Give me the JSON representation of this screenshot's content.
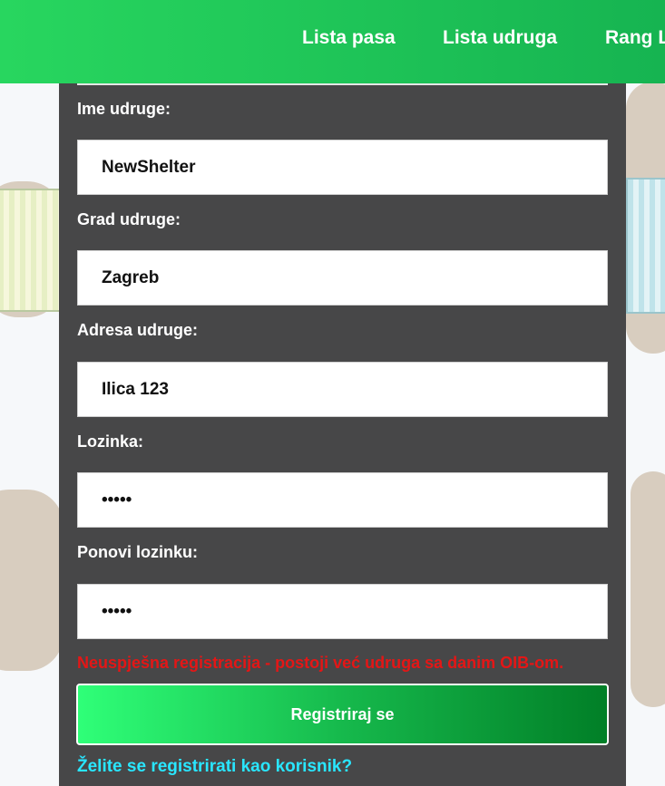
{
  "nav": {
    "links": [
      "Lista pasa",
      "Lista udruga",
      "Rang L"
    ]
  },
  "form": {
    "fields": [
      {
        "label": "Ime udruge:",
        "value": "NewShelter",
        "type": "text"
      },
      {
        "label": "Grad udruge:",
        "value": "Zagreb",
        "type": "text"
      },
      {
        "label": "Adresa udruge:",
        "value": "Ilica 123",
        "type": "text"
      },
      {
        "label": "Lozinka:",
        "value": "12345",
        "type": "password"
      },
      {
        "label": "Ponovi lozinku:",
        "value": "12345",
        "type": "password"
      }
    ],
    "error": "Neuspješna registracija - postoji već udruga sa danim OIB-om.",
    "submit_label": "Registriraj se",
    "user_link": "Želite se registrirati kao korisnik?"
  },
  "colors": {
    "nav_green": "#1cc557",
    "panel_bg": "#474748",
    "error_red": "#e41616",
    "link_cyan": "#29e6ff"
  }
}
